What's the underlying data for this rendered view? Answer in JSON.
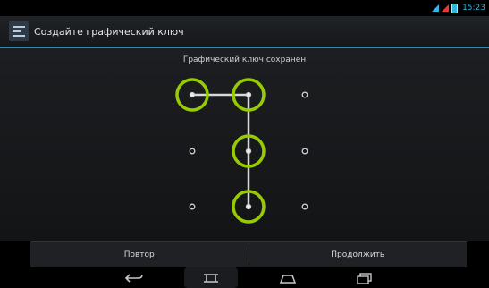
{
  "status_bar": {
    "time": "15:23"
  },
  "action_bar": {
    "title": "Создайте графический ключ"
  },
  "pattern": {
    "message": "Графический ключ сохранен",
    "grid": 3,
    "path": [
      0,
      1,
      4,
      7
    ],
    "accent_color": "#99cc00"
  },
  "buttons": {
    "retry_label": "Повтор",
    "continue_label": "Продолжить"
  },
  "nav": {
    "back": "back-icon",
    "home": "home-icon",
    "recents": "recents-icon",
    "expand": "expand-icon"
  }
}
